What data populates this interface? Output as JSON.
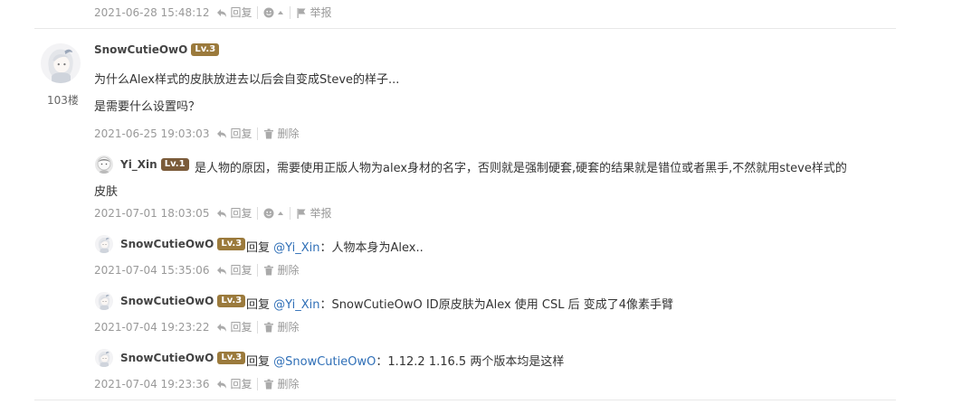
{
  "top_meta": {
    "time": "2021-06-28 15:48:12",
    "reply_label": "回复",
    "report_label": "举报"
  },
  "post": {
    "floor": "103楼",
    "username": "SnowCutieOwO",
    "level": "Lv.3",
    "line1": "为什么Alex样式的皮肤放进去以后会自变成Steve的样子...",
    "line2": "是需要什么设置吗？",
    "time": "2021-06-25 19:03:03",
    "reply_label": "回复",
    "delete_label": "删除"
  },
  "replies": [
    {
      "username": "Yi_Xin",
      "level": "Lv.1",
      "text_line1": "是人物的原因，需要使用正版人物为alex身材的名字，否则就是强制硬套,硬套的结果就是错位或者黑手,不然就用steve样式的",
      "text_line2": "皮肤",
      "time": "2021-07-01 18:03:05",
      "reply_label": "回复",
      "report_label": "举报"
    },
    {
      "username": "SnowCutieOwO",
      "level": "Lv.3",
      "prefix": "回复",
      "mention": "@Yi_Xin",
      "text": "：人物本身为Alex..",
      "time": "2021-07-04 15:35:06",
      "reply_label": "回复",
      "delete_label": "删除"
    },
    {
      "username": "SnowCutieOwO",
      "level": "Lv.3",
      "prefix": "回复",
      "mention": "@Yi_Xin",
      "text": "：SnowCutieOwO ID原皮肤为Alex 使用 CSL 后 变成了4像素手臂",
      "time": "2021-07-04 19:23:22",
      "reply_label": "回复",
      "delete_label": "删除"
    },
    {
      "username": "SnowCutieOwO",
      "level": "Lv.3",
      "prefix": "回复",
      "mention": "@SnowCutieOwO",
      "text": "：1.12.2 1.16.5 两个版本均是这样",
      "time": "2021-07-04 19:23:36",
      "reply_label": "回复",
      "delete_label": "删除"
    }
  ]
}
